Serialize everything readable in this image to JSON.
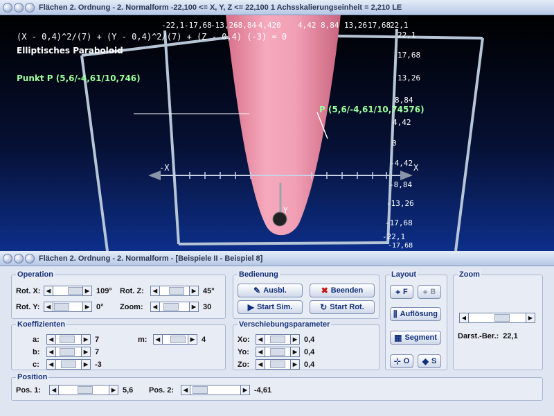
{
  "top_window": {
    "title": "Flächen 2. Ordnung - 2. Normalform   -22,100 <= X, Y, Z <= 22,100    1 Achsskalierungseinheit = 2,210 LE"
  },
  "viewport": {
    "equation": "(X - 0,4)^2/(7) + (Y - 0,4)^2/(7) + (Z - 0,4) (-3) = 0",
    "surface_name": "Elliptisches Paraboloid",
    "point_info": "Punkt P (5,6/-4,61/10,746)",
    "point_label": "P (5,6/-4,61/10,74576)",
    "x_axis_label": "X",
    "x_axis_label_neg": "-X",
    "y_axis_label": "Y",
    "top_scale": [
      "-22,1",
      "-17,68",
      "-13,26",
      "-8,84",
      "-4,42",
      "0",
      "4,42",
      "8,84",
      "13,26",
      "17,68",
      "22,1"
    ],
    "side_scale": [
      "22,1",
      "17,68",
      "13,26",
      "8,84",
      "4,42",
      "0",
      "-4,42",
      "-8,84",
      "-13,26",
      "-17,68",
      "-22,1",
      "-17,68"
    ]
  },
  "bottom_window": {
    "title": "Flächen 2. Ordnung  - 2. Normalform - [Beispiele II - Beispiel 8]"
  },
  "operation": {
    "title": "Operation",
    "rot_x_label": "Rot. X:",
    "rot_x_value": "109°",
    "rot_z_label": "Rot. Z:",
    "rot_z_value": "45°",
    "rot_y_label": "Rot. Y:",
    "rot_y_value": "0°",
    "zoom_label": "Zoom:",
    "zoom_value": "30"
  },
  "koeffizienten": {
    "title": "Koeffizienten",
    "a_label": "a:",
    "a_value": "7",
    "b_label": "b:",
    "b_value": "7",
    "c_label": "c:",
    "c_value": "-3",
    "m_label": "m:",
    "m_value": "4"
  },
  "bedienung": {
    "title": "Bedienung",
    "ausbl": "Ausbl.",
    "beenden": "Beenden",
    "start_sim": "Start Sim.",
    "start_rot": "Start Rot."
  },
  "verschiebung": {
    "title": "Verschiebungsparameter",
    "xo_label": "Xo:",
    "xo_value": "0,4",
    "yo_label": "Yo:",
    "yo_value": "0,4",
    "zo_label": "Zo:",
    "zo_value": "0,4"
  },
  "layout": {
    "title": "Layout",
    "f_label": "F",
    "b_label": "B",
    "aufloesung": "Auflösung",
    "segment": "Segment",
    "o_label": "O",
    "s_label": "S"
  },
  "zoom_group": {
    "title": "Zoom",
    "darst_label": "Darst.-Ber.:",
    "darst_value": "22,1"
  },
  "position": {
    "title": "Position",
    "pos1_label": "Pos. 1:",
    "pos1_value": "5,6",
    "pos2_label": "Pos. 2:",
    "pos2_value": "-4,61"
  }
}
